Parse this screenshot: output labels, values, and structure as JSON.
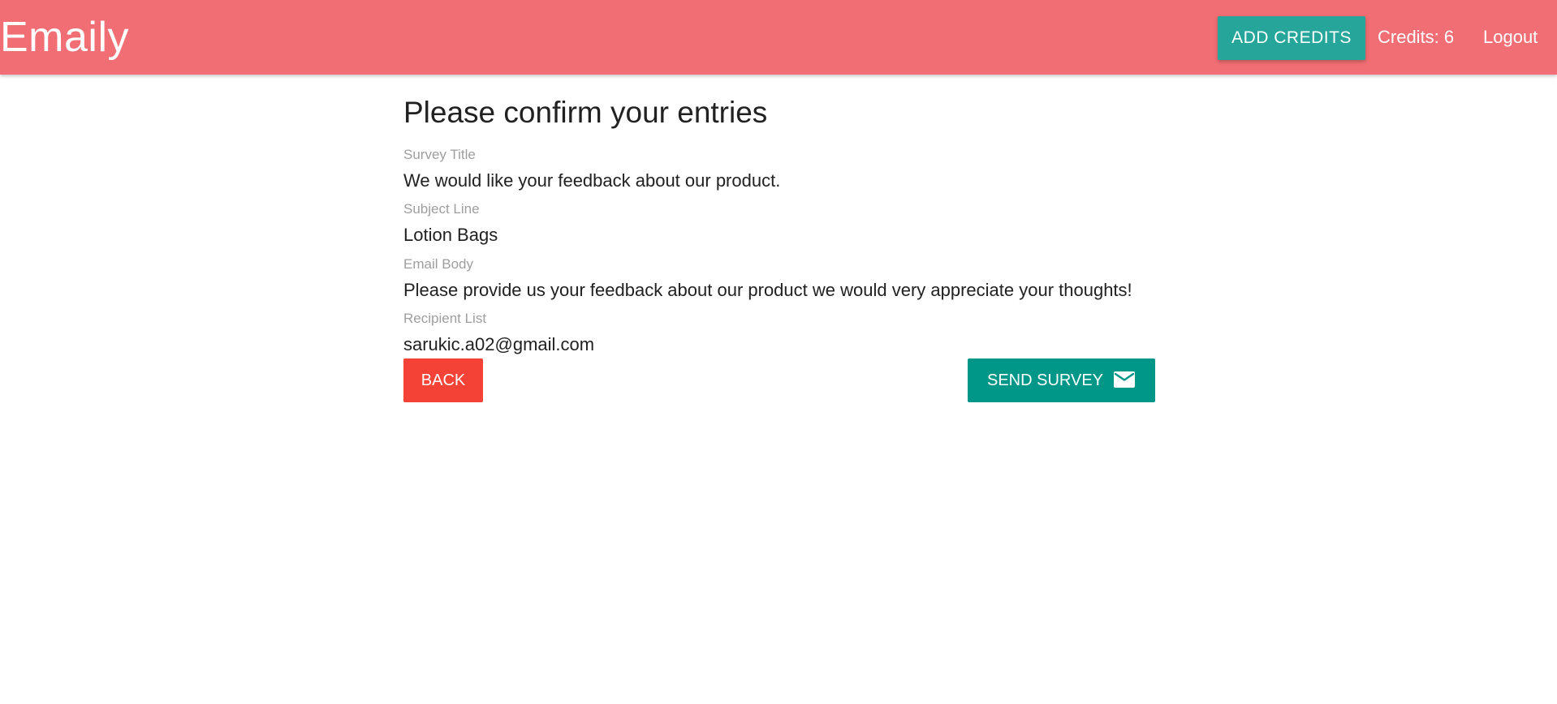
{
  "app": {
    "brand": "Emaily"
  },
  "header": {
    "add_credits_label": "Add Credits",
    "credits_text": "Credits: 6",
    "logout_label": "Logout"
  },
  "review": {
    "title": "Please confirm your entries",
    "fields": [
      {
        "label": "Survey Title",
        "value": "We would like your feedback about our product."
      },
      {
        "label": "Subject Line",
        "value": "Lotion Bags"
      },
      {
        "label": "Email Body",
        "value": "Please provide us your feedback about our product we would very appreciate your thoughts!"
      },
      {
        "label": "Recipient List",
        "value": "sarukic.a02@gmail.com"
      }
    ],
    "back_label": "Back",
    "send_label": "Send Survey",
    "send_icon": "email-icon"
  },
  "colors": {
    "navbar": "#f06e74",
    "add_credits_button": "#26a69a",
    "back_button": "#f44336",
    "send_button": "#009688"
  }
}
